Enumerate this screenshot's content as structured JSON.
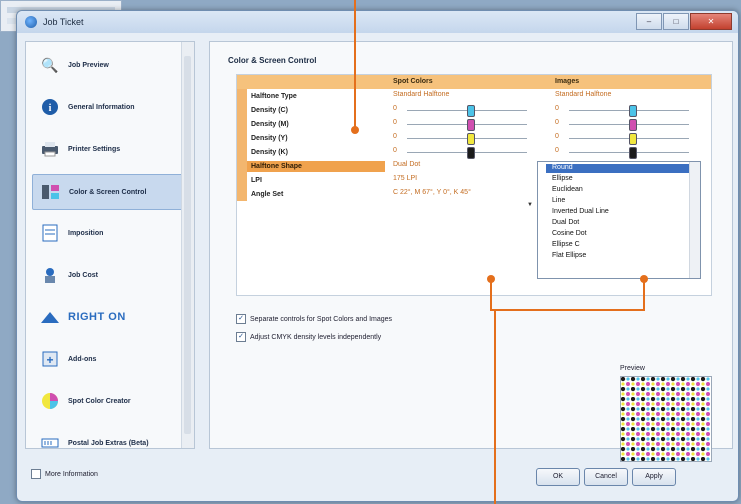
{
  "window": {
    "title": "Job Ticket"
  },
  "window_buttons": {
    "minimize": "–",
    "maximize": "□",
    "close": "✕"
  },
  "sidebar": {
    "items": [
      {
        "label": "Job Preview",
        "icon": "magnifier-icon"
      },
      {
        "label": "General Information",
        "icon": "info-icon"
      },
      {
        "label": "Printer Settings",
        "icon": "printer-icon"
      },
      {
        "label": "Color & Screen Control",
        "icon": "color-screen-icon"
      },
      {
        "label": "Imposition",
        "icon": "imposition-icon"
      },
      {
        "label": "Job Cost",
        "icon": "job-cost-icon"
      },
      {
        "label": "RIGHT ON",
        "icon": "righton-logo-icon"
      },
      {
        "label": "Add-ons",
        "icon": "addons-icon"
      },
      {
        "label": "Spot Color Creator",
        "icon": "spot-color-icon"
      },
      {
        "label": "Postal Job Extras (Beta)",
        "icon": "postal-icon"
      }
    ],
    "active": "Color & Screen Control"
  },
  "main": {
    "section_title": "Color & Screen Control",
    "columns": {
      "spot": "Spot Colors",
      "images": "Images"
    },
    "rows": [
      {
        "label": "Halftone Type",
        "spot": "Standard Halftone",
        "images": "Standard Halftone"
      },
      {
        "label": "Density (C)",
        "spot": "0",
        "images": "0"
      },
      {
        "label": "Density (M)",
        "spot": "0",
        "images": "0"
      },
      {
        "label": "Density (Y)",
        "spot": "0",
        "images": "0"
      },
      {
        "label": "Density (K)",
        "spot": "0",
        "images": "0"
      },
      {
        "label": "Halftone Shape",
        "spot": "Dual Dot",
        "images": "Round"
      },
      {
        "label": "LPI",
        "spot": "175 LPI",
        "images": ""
      },
      {
        "label": "Angle Set",
        "spot": "C 22°, M 67°, Y 0°, K 45°",
        "images": ""
      }
    ],
    "dropdown_options": [
      "Round",
      "Ellipse",
      "Euclidean",
      "Line",
      "Inverted Dual Line",
      "Dual Dot",
      "Cosine Dot",
      "Ellipse C",
      "Flat Ellipse"
    ],
    "dropdown_selected": "Round",
    "checkbox1": "Separate controls for Spot Colors and Images",
    "checkbox2": "Adjust CMYK density levels independently",
    "preview_label": "Preview",
    "colors": {
      "cyan": "#4cc3e8",
      "magenta": "#d04fb0",
      "yellow": "#f1e73e",
      "black": "#1b1b1b",
      "accent": "#e46f1c"
    }
  },
  "footer": {
    "more_info": "More Information",
    "ok": "OK",
    "cancel": "Cancel",
    "apply": "Apply"
  }
}
